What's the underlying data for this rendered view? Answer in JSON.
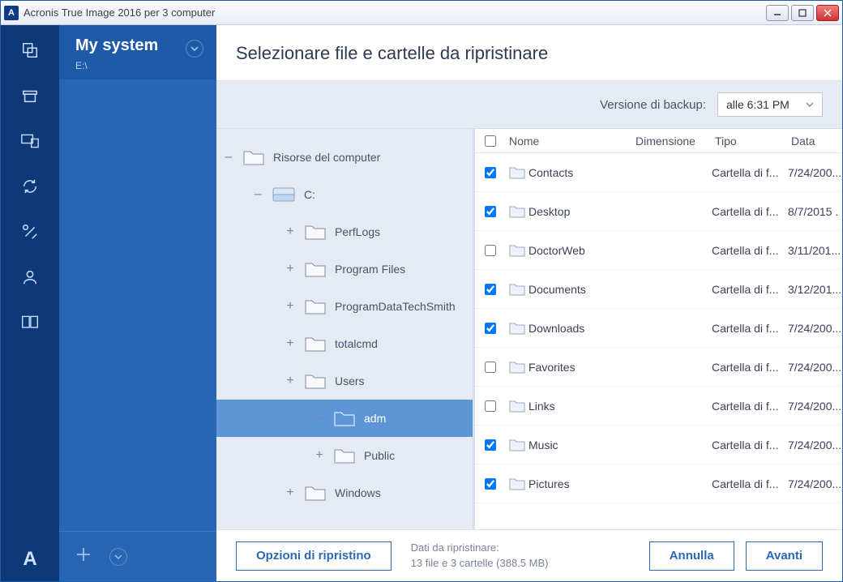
{
  "window": {
    "title": "Acronis True Image 2016 per 3 computer"
  },
  "sidebar": {
    "name": "My system",
    "path": "E:\\"
  },
  "page": {
    "title": "Selezionare file e cartelle da ripristinare"
  },
  "version": {
    "label": "Versione di backup:",
    "selected": "alle 6:31 PM"
  },
  "tree": {
    "root": "Risorse del computer",
    "drive": "C:",
    "nodes": [
      {
        "label": "PerfLogs"
      },
      {
        "label": "Program Files"
      },
      {
        "label": "ProgramDataTechSmith"
      },
      {
        "label": "totalcmd"
      },
      {
        "label": "Users"
      },
      {
        "label": "adm",
        "selected": true
      },
      {
        "label": "Public"
      },
      {
        "label": "Windows"
      }
    ]
  },
  "table": {
    "headers": {
      "name": "Nome",
      "size": "Dimensione",
      "type": "Tipo",
      "date": "Data"
    },
    "rows": [
      {
        "checked": true,
        "name": "Contacts",
        "type": "Cartella di f...",
        "date": "7/24/200..."
      },
      {
        "checked": true,
        "name": "Desktop",
        "type": "Cartella di f...",
        "date": "8/7/2015 ."
      },
      {
        "checked": false,
        "name": "DoctorWeb",
        "type": "Cartella di f...",
        "date": "3/11/201..."
      },
      {
        "checked": true,
        "name": "Documents",
        "type": "Cartella di f...",
        "date": "3/12/201..."
      },
      {
        "checked": true,
        "name": "Downloads",
        "type": "Cartella di f...",
        "date": "7/24/200..."
      },
      {
        "checked": false,
        "name": "Favorites",
        "type": "Cartella di f...",
        "date": "7/24/200..."
      },
      {
        "checked": false,
        "name": "Links",
        "type": "Cartella di f...",
        "date": "7/24/200..."
      },
      {
        "checked": true,
        "name": "Music",
        "type": "Cartella di f...",
        "date": "7/24/200..."
      },
      {
        "checked": true,
        "name": "Pictures",
        "type": "Cartella di f...",
        "date": "7/24/200..."
      }
    ]
  },
  "footer": {
    "options": "Opzioni di ripristino",
    "summary_label": "Dati da ripristinare:",
    "summary_value": "13 file e 3 cartelle (388.5 MB)",
    "cancel": "Annulla",
    "next": "Avanti"
  }
}
